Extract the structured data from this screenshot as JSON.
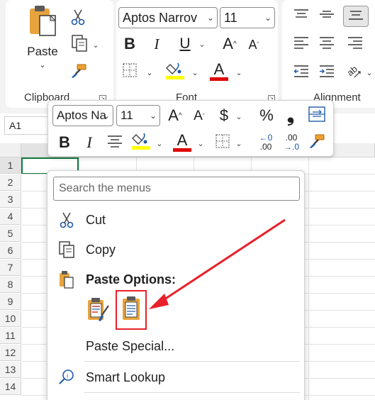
{
  "ribbon": {
    "clipboard": {
      "paste_label": "Paste",
      "caret": "⌄",
      "group_label": "Clipboard",
      "cut_icon": "scissors-icon",
      "copy_icon": "copy-icon",
      "format_painter_icon": "format-painter-icon"
    },
    "font": {
      "font_name": "Aptos Narrov",
      "font_size": "11",
      "bold": "B",
      "italic": "I",
      "underline": "U",
      "grow": "A",
      "shrink": "A",
      "font_color": "A",
      "group_label": "Font"
    },
    "alignment": {
      "group_label": "Alignment"
    }
  },
  "formula_bar": {
    "name_box": "A1"
  },
  "grid": {
    "rows": [
      "1",
      "2",
      "3",
      "4",
      "5",
      "6",
      "7",
      "8",
      "9",
      "10",
      "11",
      "12",
      "13",
      "14"
    ]
  },
  "mini_toolbar": {
    "font_name": "Aptos Na",
    "font_size": "11",
    "grow": "A",
    "shrink": "A",
    "currency": "$",
    "percent": "%",
    "comma": "❟",
    "bold": "B",
    "italic": "I",
    "font_color": "A",
    "inc_decimal_top": "←0",
    "inc_decimal_bottom": ".00",
    "dec_decimal_top": ".00",
    "dec_decimal_bottom": "→.0"
  },
  "context_menu": {
    "search_placeholder": "Search the menus",
    "items": [
      {
        "label": "Cut",
        "icon": "scissors-icon"
      },
      {
        "label": "Copy",
        "icon": "copy-icon"
      },
      {
        "label": "Paste Options:",
        "icon": "clipboard-icon"
      },
      {
        "label": "Paste Special...",
        "icon": ""
      },
      {
        "label": "Smart Lookup",
        "icon": "smart-lookup-icon"
      }
    ],
    "paste_options": [
      "paste-keep-formatting-icon",
      "paste-values-icon"
    ]
  },
  "colors": {
    "accent_green": "#107c41",
    "highlight_red": "#e8202a",
    "font_red": "#e00000",
    "highlight_yellow": "#ffff00",
    "clipboard_orange": "#e8a33d"
  }
}
